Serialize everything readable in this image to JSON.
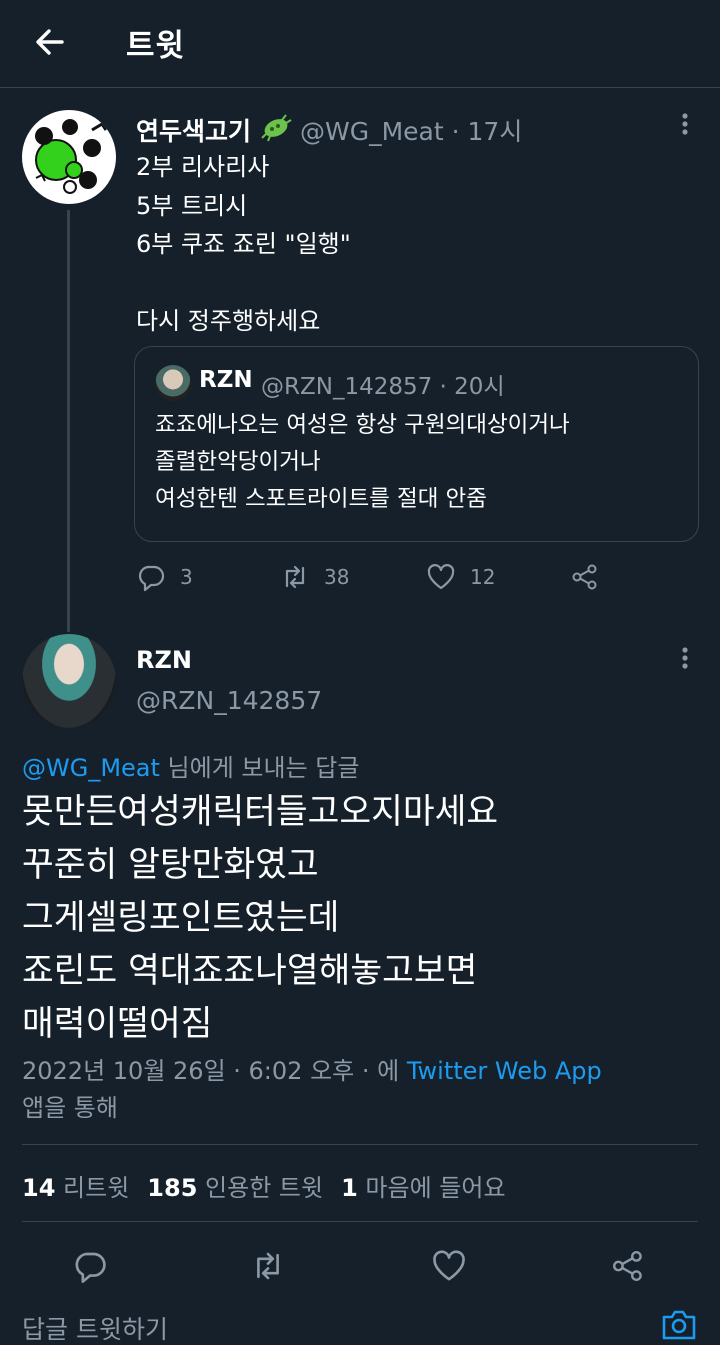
{
  "header": {
    "title": "트윗"
  },
  "tweet1": {
    "name": "연두색고기",
    "meta": "@WG_Meat · 17시",
    "body": "2부 리사리사\n5부 트리시\n6부 쿠죠 죠린 \"일행\"\n\n다시 정주행하세요",
    "quote": {
      "name": "RZN",
      "meta": "@RZN_142857 · 20시",
      "body": "죠죠에나오는 여성은 항상 구원의대상이거나\n졸렬한악당이거나\n여성한텐 스포트라이트를 절대 안줌"
    },
    "actions": {
      "replies": "3",
      "retweets": "38",
      "likes": "12"
    }
  },
  "tweet2": {
    "name": "RZN",
    "handle": "@RZN_142857",
    "replying_handle": "@WG_Meat",
    "replying_suffix": " 님에게 보내는 답글",
    "body": "못만든여성캐릭터들고오지마세요\n꾸준히 알탕만화였고\n그게셀링포인트였는데\n죠린도 역대죠죠나열해놓고보면\n매력이떨어짐",
    "time": "2022년 10월 26일 · 6:02 오후 · 에 ",
    "source": "Twitter Web App",
    "source_suffix": "앱을 통해",
    "stats": {
      "retweets_count": "14",
      "retweets_label": "리트윗",
      "quotes_count": "185",
      "quotes_label": "인용한 트윗",
      "likes_count": "1",
      "likes_label": "마음에 들어요"
    }
  },
  "reply_bar": {
    "placeholder": "답글 트윗하기"
  },
  "colors": {
    "background": "#15202b",
    "accent": "#1d9bf0",
    "muted": "#8b98a5",
    "border": "#38444d"
  }
}
